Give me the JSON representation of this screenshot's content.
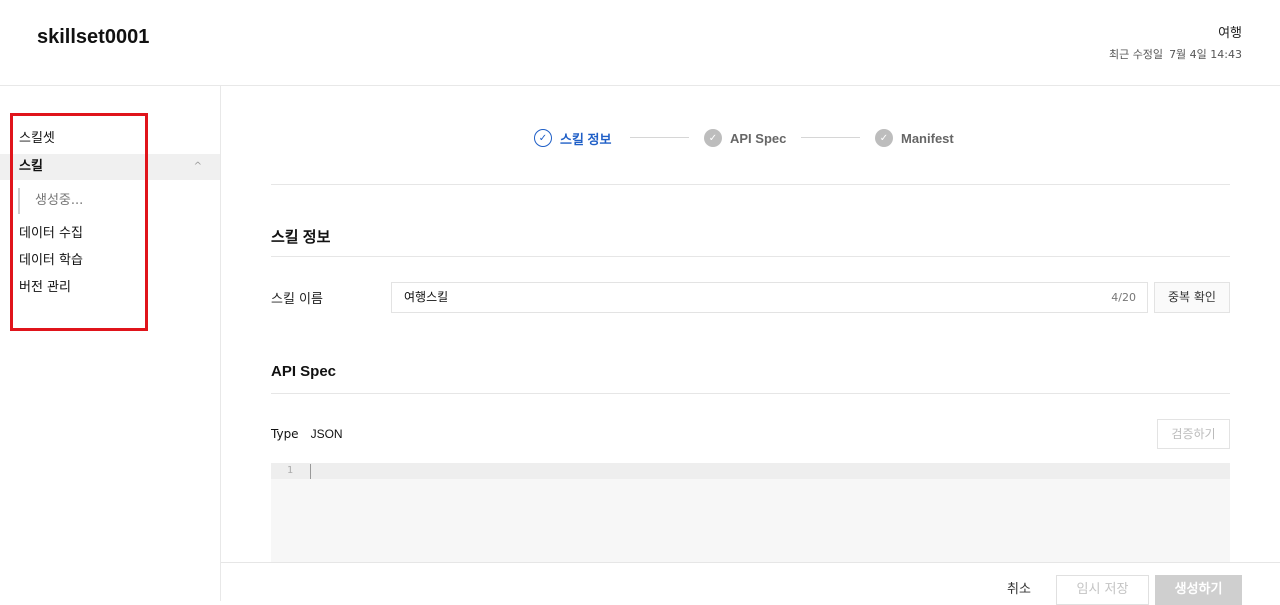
{
  "header": {
    "title": "skillset0001",
    "project": "여행",
    "modified_label": "최근 수정일",
    "modified_value": "7월 4일 14:43"
  },
  "sidebar": {
    "items": [
      {
        "label": "스킬셋"
      },
      {
        "label": "스킬"
      },
      {
        "label": "생성중..."
      },
      {
        "label": "데이터 수집"
      },
      {
        "label": "데이터 학습"
      },
      {
        "label": "버전 관리"
      }
    ],
    "chevron": "^"
  },
  "stepper": {
    "steps": [
      {
        "label": "스킬 정보",
        "state": "current"
      },
      {
        "label": "API Spec",
        "state": "todo"
      },
      {
        "label": "Manifest",
        "state": "todo"
      }
    ]
  },
  "skill_info": {
    "section_title": "스킬 정보",
    "name_label": "스킬 이름",
    "name_value": "여행스킬",
    "name_count": "4/20",
    "dup_check_label": "중복 확인"
  },
  "api_spec": {
    "section_title": "API Spec",
    "type_label": "Type",
    "type_value": "JSON",
    "validate_label": "검증하기",
    "line_number": "1"
  },
  "footer": {
    "cancel_label": "취소",
    "temp_save_label": "임시 저장",
    "create_label": "생성하기"
  },
  "colors": {
    "accent": "#1f5fc7",
    "highlight_box": "#e0141b",
    "step_inactive": "#bdbdbd"
  }
}
